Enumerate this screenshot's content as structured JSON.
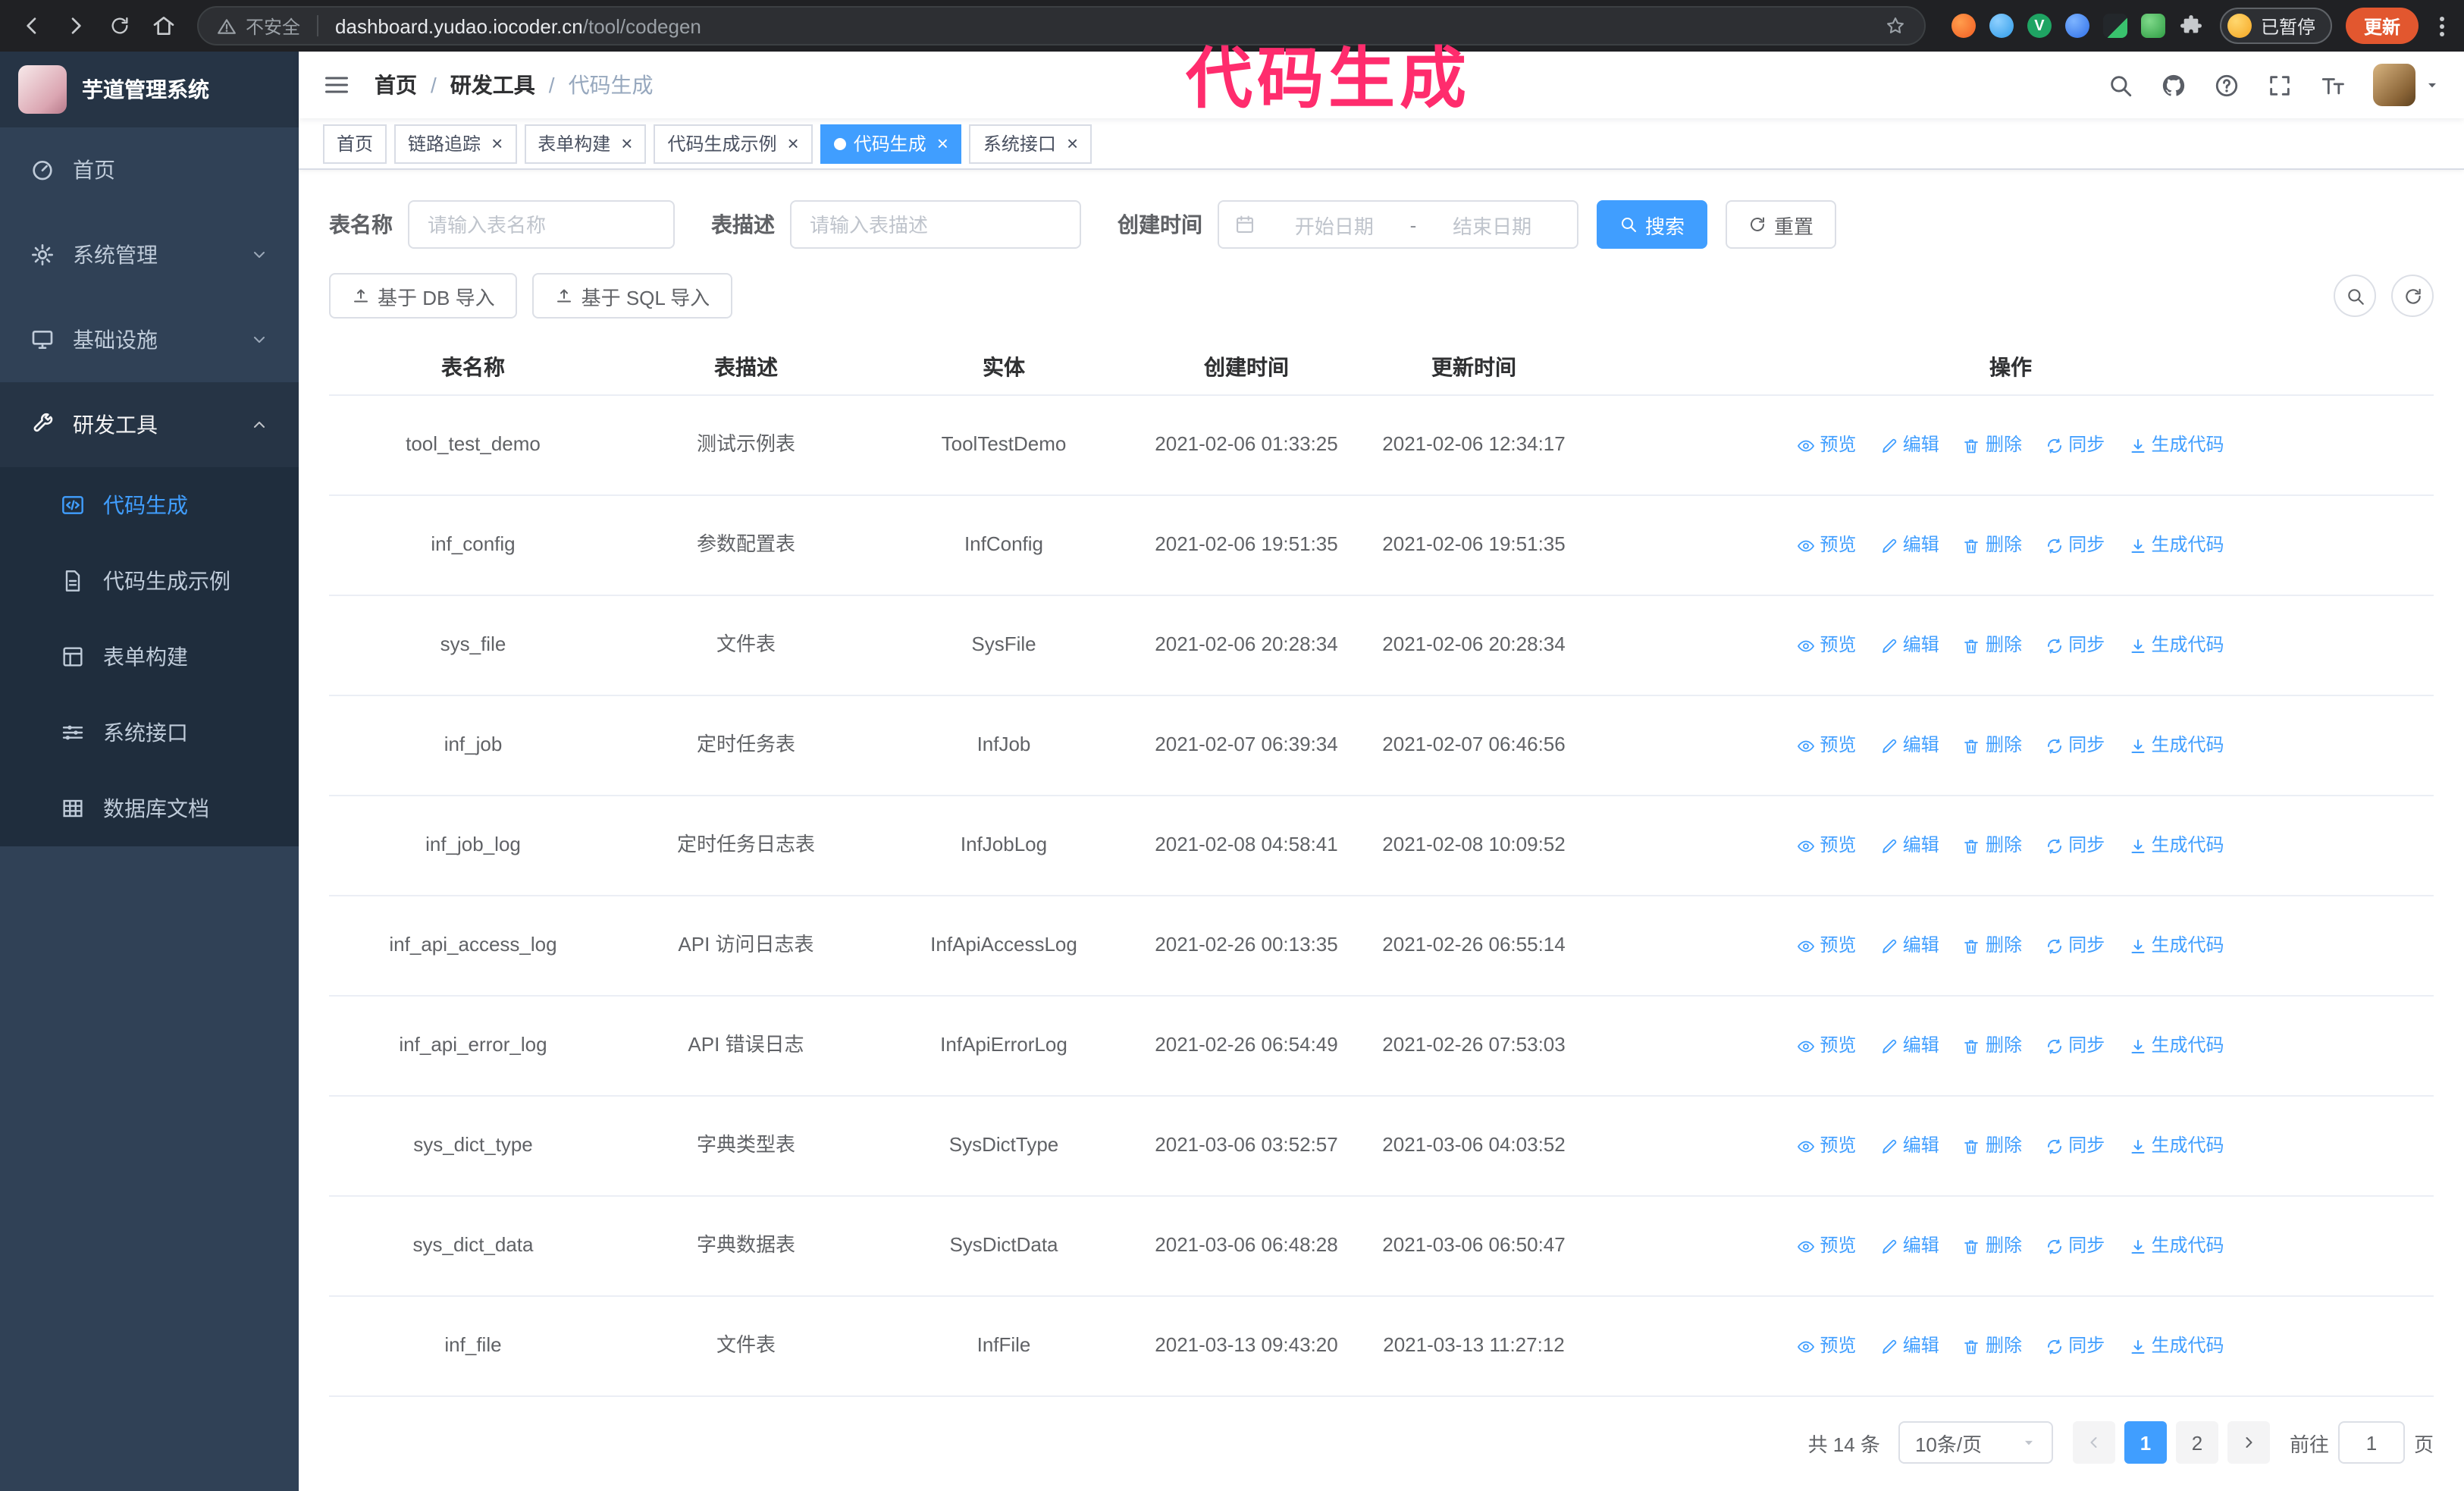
{
  "browser": {
    "security_text": "不安全",
    "url_host": "dashboard.yudao.iocoder.cn",
    "url_path": "/tool/codegen",
    "paused_label": "已暂停",
    "update_label": "更新"
  },
  "annotation": {
    "text": "代码生成",
    "color": "#ff2c6d"
  },
  "icons": {
    "close": "×"
  },
  "app": {
    "logo_title": "芋道管理系统",
    "sidebar": {
      "items": [
        {
          "label": "首页"
        },
        {
          "label": "系统管理",
          "expandable": true
        },
        {
          "label": "基础设施",
          "expandable": true
        },
        {
          "label": "研发工具",
          "expandable": true,
          "expanded": true
        }
      ],
      "submenu": [
        {
          "label": "代码生成",
          "active": true
        },
        {
          "label": "代码生成示例"
        },
        {
          "label": "表单构建"
        },
        {
          "label": "系统接口"
        },
        {
          "label": "数据库文档"
        }
      ]
    },
    "breadcrumb": {
      "items": [
        "首页",
        "研发工具",
        "代码生成"
      ],
      "separator": "/"
    },
    "tabs": [
      {
        "label": "首页",
        "closable": false,
        "active": false
      },
      {
        "label": "链路追踪",
        "closable": true,
        "active": false
      },
      {
        "label": "表单构建",
        "closable": true,
        "active": false
      },
      {
        "label": "代码生成示例",
        "closable": true,
        "active": false
      },
      {
        "label": "代码生成",
        "closable": true,
        "active": true
      },
      {
        "label": "系统接口",
        "closable": true,
        "active": false
      }
    ]
  },
  "filters": {
    "table_name_label": "表名称",
    "table_name_placeholder": "请输入表名称",
    "table_desc_label": "表描述",
    "table_desc_placeholder": "请输入表描述",
    "create_time_label": "创建时间",
    "date_start_placeholder": "开始日期",
    "date_separator": "-",
    "date_end_placeholder": "结束日期",
    "search_label": "搜索",
    "reset_label": "重置"
  },
  "toolbar": {
    "import_db_label": "基于 DB 导入",
    "import_sql_label": "基于 SQL 导入"
  },
  "table": {
    "columns": [
      "表名称",
      "表描述",
      "实体",
      "创建时间",
      "更新时间",
      "操作"
    ],
    "actions": [
      "预览",
      "编辑",
      "删除",
      "同步",
      "生成代码"
    ],
    "rows": [
      {
        "name": "tool_test_demo",
        "desc": "测试示例表",
        "entity": "ToolTestDemo",
        "created": "2021-02-06 01:33:25",
        "updated": "2021-02-06 12:34:17"
      },
      {
        "name": "inf_config",
        "desc": "参数配置表",
        "entity": "InfConfig",
        "created": "2021-02-06 19:51:35",
        "updated": "2021-02-06 19:51:35"
      },
      {
        "name": "sys_file",
        "desc": "文件表",
        "entity": "SysFile",
        "created": "2021-02-06 20:28:34",
        "updated": "2021-02-06 20:28:34"
      },
      {
        "name": "inf_job",
        "desc": "定时任务表",
        "entity": "InfJob",
        "created": "2021-02-07 06:39:34",
        "updated": "2021-02-07 06:46:56"
      },
      {
        "name": "inf_job_log",
        "desc": "定时任务日志表",
        "entity": "InfJobLog",
        "created": "2021-02-08 04:58:41",
        "updated": "2021-02-08 10:09:52"
      },
      {
        "name": "inf_api_access_log",
        "desc": "API 访问日志表",
        "entity": "InfApiAccessLog",
        "created": "2021-02-26 00:13:35",
        "updated": "2021-02-26 06:55:14"
      },
      {
        "name": "inf_api_error_log",
        "desc": "API 错误日志",
        "entity": "InfApiErrorLog",
        "created": "2021-02-26 06:54:49",
        "updated": "2021-02-26 07:53:03"
      },
      {
        "name": "sys_dict_type",
        "desc": "字典类型表",
        "entity": "SysDictType",
        "created": "2021-03-06 03:52:57",
        "updated": "2021-03-06 04:03:52"
      },
      {
        "name": "sys_dict_data",
        "desc": "字典数据表",
        "entity": "SysDictData",
        "created": "2021-03-06 06:48:28",
        "updated": "2021-03-06 06:50:47"
      },
      {
        "name": "inf_file",
        "desc": "文件表",
        "entity": "InfFile",
        "created": "2021-03-13 09:43:20",
        "updated": "2021-03-13 11:27:12"
      }
    ]
  },
  "pagination": {
    "total_text": "共 14 条",
    "page_size_label": "10条/页",
    "pages": [
      "1",
      "2"
    ],
    "active_page": "1",
    "goto_label": "前往",
    "goto_value": "1",
    "page_unit": "页"
  },
  "colors": {
    "accent": "#409eff",
    "sidebar_bg": "#304156",
    "submenu_bg": "#1f2d3d",
    "annotation": "#ff2c6d",
    "update_button": "#e2572f"
  }
}
